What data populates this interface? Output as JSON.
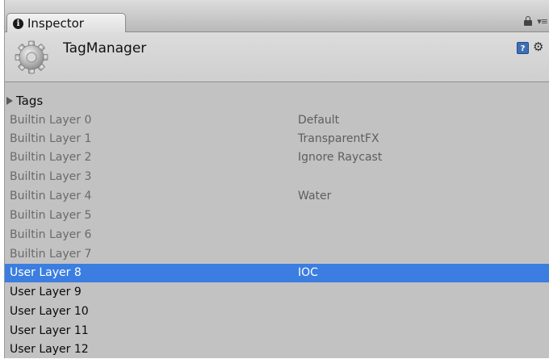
{
  "tab": {
    "title": "Inspector"
  },
  "header": {
    "title": "TagManager"
  },
  "tags": {
    "label": "Tags"
  },
  "layers": [
    {
      "label": "Builtin Layer 0",
      "value": "Default"
    },
    {
      "label": "Builtin Layer 1",
      "value": "TransparentFX"
    },
    {
      "label": "Builtin Layer 2",
      "value": "Ignore Raycast"
    },
    {
      "label": "Builtin Layer 3",
      "value": ""
    },
    {
      "label": "Builtin Layer 4",
      "value": "Water"
    },
    {
      "label": "Builtin Layer 5",
      "value": ""
    },
    {
      "label": "Builtin Layer 6",
      "value": ""
    },
    {
      "label": "Builtin Layer 7",
      "value": ""
    },
    {
      "label": "User Layer 8",
      "value": "IOC",
      "selected": true
    },
    {
      "label": "User Layer 9",
      "value": ""
    },
    {
      "label": "User Layer 10",
      "value": ""
    },
    {
      "label": "User Layer 11",
      "value": ""
    },
    {
      "label": "User Layer 12",
      "value": ""
    }
  ],
  "icons": {
    "tab": "info-icon",
    "lock": "lock-icon",
    "menu": "menu-icon",
    "component": "gear-icon",
    "help": "help-icon",
    "settings": "settings-icon",
    "expand": "triangle-right-icon"
  },
  "colors": {
    "selection": "#3b7de0",
    "panel": "#c2c2c2",
    "builtin_text": "#6a6a6a"
  }
}
